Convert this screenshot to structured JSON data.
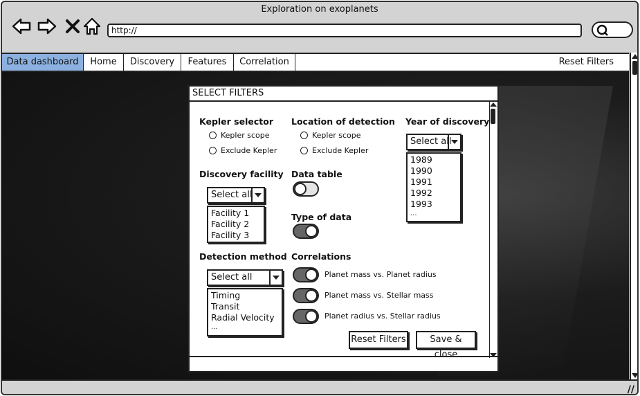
{
  "window": {
    "title": "Exploration on exoplanets"
  },
  "browser": {
    "url": "http://"
  },
  "tabs": [
    "Data dashboard",
    "Home",
    "Discovery",
    "Features",
    "Correlation"
  ],
  "top_reset": "Reset Filters",
  "dialog": {
    "title": "SELECT FILTERS",
    "kepler_selector": {
      "heading": "Kepler selector",
      "options": [
        "Kepler scope",
        "Exclude Kepler"
      ]
    },
    "location": {
      "heading": "Location of detection",
      "options": [
        "Kepler scope",
        "Exclude Kepler"
      ]
    },
    "year": {
      "heading": "Year of discovery",
      "select": "Select all",
      "items": [
        "1989",
        "1990",
        "1991",
        "1992",
        "1993",
        "..."
      ]
    },
    "facility": {
      "heading": "Discovery facility",
      "select": "Select all",
      "items": [
        "Facility 1",
        "Facility 2",
        "Facility 3"
      ]
    },
    "data_table": {
      "heading": "Data table"
    },
    "type_of_data": {
      "heading": "Type of data"
    },
    "method": {
      "heading": "Detection method",
      "select": "Select all",
      "items": [
        "Timing",
        "Transit",
        "Radial Velocity",
        "..."
      ]
    },
    "correlations": {
      "heading": "Correlations",
      "items": [
        "Planet mass vs. Planet radius",
        "Planet mass vs. Stellar mass",
        "Planet radius vs. Stellar radius"
      ]
    },
    "reset_button": "Reset Filters",
    "save_button": "Save & close"
  }
}
